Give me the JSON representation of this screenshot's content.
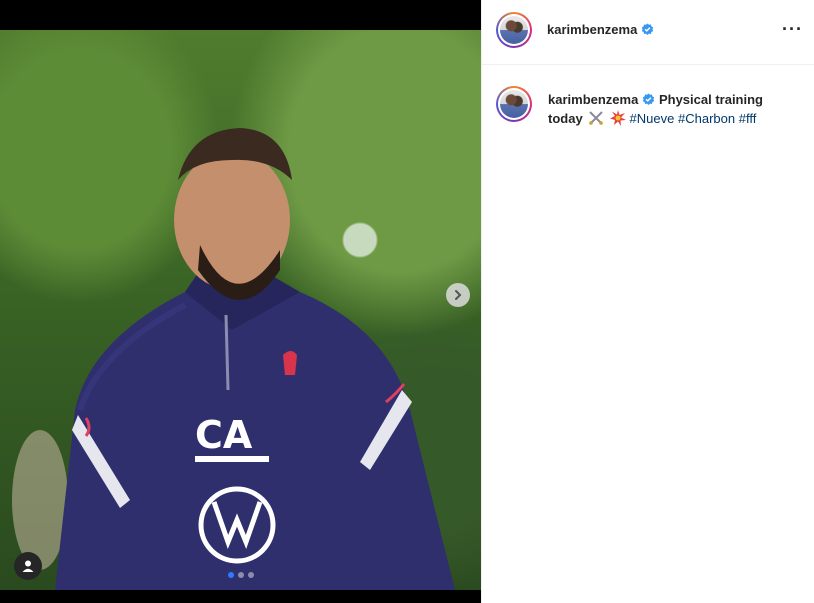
{
  "post": {
    "username": "karimbenzema",
    "caption": {
      "text": "Physical training today",
      "hashtags": [
        "#Nueve",
        "#Charbon",
        "#fff"
      ]
    },
    "carousel": {
      "current_index": 1,
      "total": 3
    },
    "icons": {
      "verified": "verified-badge-icon",
      "more": "more-options-icon",
      "next": "chevron-right-icon",
      "tags": "user-tag-icon",
      "emoji_1": "crossed-swords-emoji",
      "emoji_2": "collision-emoji"
    }
  },
  "colors": {
    "verified_blue": "#3897f0",
    "hashtag": "#00376b",
    "active_dot": "#2b7cff"
  }
}
